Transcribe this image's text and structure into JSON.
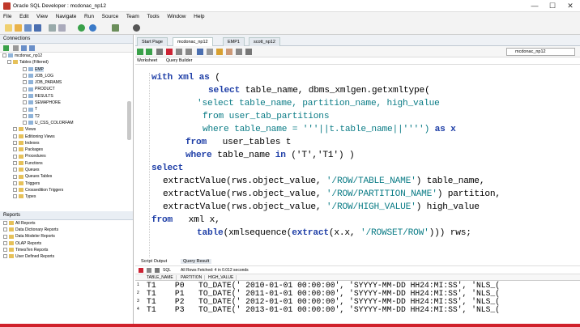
{
  "window": {
    "title": "Oracle SQL Developer : mcdonac_np12",
    "minimize": "—",
    "maximize": "☐",
    "close": "✕"
  },
  "menu": [
    "File",
    "Edit",
    "View",
    "Navigate",
    "Run",
    "Source",
    "Team",
    "Tools",
    "Window",
    "Help"
  ],
  "connections": {
    "header": "Connections",
    "root": "mcdonac_np12",
    "tables_node": "Tables (Filtered)",
    "tables": [
      "EMP",
      "JOB_LOG",
      "JOB_PARAMS",
      "PRODUCT",
      "RESULTS",
      "SEMAPHORE",
      "T",
      "T2",
      "U_CSS_COLORFAM"
    ],
    "nodes": [
      "Views",
      "Editioning Views",
      "Indexes",
      "Packages",
      "Procedures",
      "Functions",
      "Queues",
      "Queues Tables",
      "Triggers",
      "Crossedition Triggers",
      "Types"
    ]
  },
  "reports": {
    "header": "Reports",
    "items": [
      "All Reports",
      "Data Dictionary Reports",
      "Data Modeler Reports",
      "OLAP Reports",
      "TimesTen Reports",
      "User Defined Reports"
    ]
  },
  "doc_tabs": [
    "Start Page",
    "mcdonac_np12",
    "EMP1",
    "scott_np12"
  ],
  "connection_selector": "mcdonac_np12",
  "worksheet_tabs": [
    "Worksheet",
    "Query Builder"
  ],
  "code": {
    "l1a": "with",
    "l1b": "xml",
    "l1c": "as",
    "l1d": "(",
    "l2a": "select",
    "l2b": "table_name, dbms_xmlgen.getxmltype(",
    "l3": "'select table_name, partition_name, high_value",
    "l4": "from user_tab_partitions",
    "l5a": "where table_name = '''||t.table_name||'''')",
    "l5b": "as",
    "l5c": "x",
    "l6a": "from",
    "l6b": "user_tables t",
    "l7a": "where",
    "l7b": "table_name",
    "l7c": "in",
    "l7d": "('T','T1') )",
    "l8": "select",
    "l9a": "extractValue(rws.object_value, ",
    "l9b": "'/ROW/TABLE_NAME'",
    "l9c": ") table_name,",
    "l10a": "extractValue(rws.object_value, ",
    "l10b": "'/ROW/PARTITION_NAME'",
    "l10c": ") partition,",
    "l11a": "extractValue(rws.object_value, ",
    "l11b": "'/ROW/HIGH_VALUE'",
    "l11c": ") high_value",
    "l12a": "from",
    "l12b": "xml x,",
    "l13a": "table",
    "l13b": "(xmlsequence(",
    "l13c": "extract",
    "l13d": "(x.x, ",
    "l13e": "'/ROWSET/ROW'",
    "l13f": "))) rws;"
  },
  "output": {
    "tabs": [
      "Script Output",
      "Query Result"
    ],
    "sql_label": "SQL",
    "status": "All Rows Fetched: 4 in 0.012 seconds",
    "columns": [
      "TABLE_NAME",
      "PARTITION",
      "HIGH_VALUE"
    ],
    "rows": [
      {
        "n": "1",
        "t": "T1",
        "p": "P0",
        "h": "TO_DATE(' 2010-01-01 00:00:00', 'SYYYY-MM-DD HH24:MI:SS', 'NLS_("
      },
      {
        "n": "2",
        "t": "T1",
        "p": "P1",
        "h": "TO_DATE(' 2011-01-01 00:00:00', 'SYYYY-MM-DD HH24:MI:SS', 'NLS_("
      },
      {
        "n": "3",
        "t": "T1",
        "p": "P2",
        "h": "TO_DATE(' 2012-01-01 00:00:00', 'SYYYY-MM-DD HH24:MI:SS', 'NLS_("
      },
      {
        "n": "4",
        "t": "T1",
        "p": "P3",
        "h": "TO_DATE(' 2013-01-01 00:00:00', 'SYYYY-MM-DD HH24:MI:SS', 'NLS_("
      }
    ]
  }
}
